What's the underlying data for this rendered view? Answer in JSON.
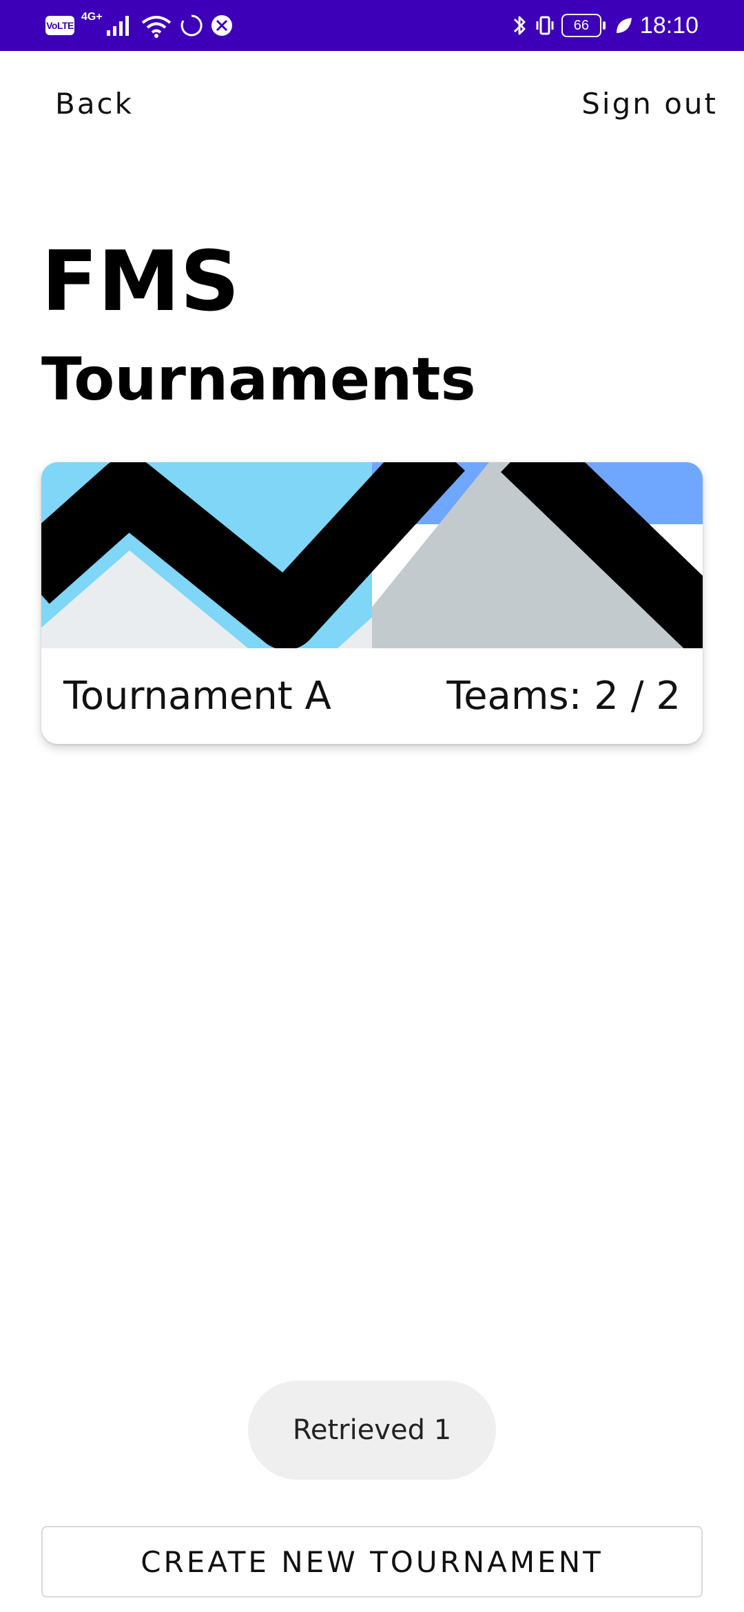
{
  "colors": {
    "status_bar_bg": "#3D00B8",
    "card_sky": "#7FD6F6",
    "card_sky_right": "#6FA7FF",
    "card_mountain_light": "#E9EDF0",
    "card_mountain_gray": "#C3CACD"
  },
  "status_bar": {
    "time": "18:10",
    "volte_label": "VoLTE",
    "network_label": "4G+",
    "battery_level": "66",
    "icons": [
      "signal-icon",
      "wifi-icon",
      "sync-icon",
      "app-icon",
      "bluetooth-icon",
      "vibrate-icon",
      "battery-icon",
      "leaf-icon"
    ]
  },
  "header": {
    "back_label": "Back",
    "sign_out_label": "Sign out"
  },
  "app_title": "FMS",
  "page_title": "Tournaments",
  "tournaments": [
    {
      "name": "Tournament A",
      "teams_label": "Teams: 2 / 2"
    }
  ],
  "toast": {
    "message": "Retrieved 1"
  },
  "create_button_label": "CREATE NEW TOURNAMENT"
}
